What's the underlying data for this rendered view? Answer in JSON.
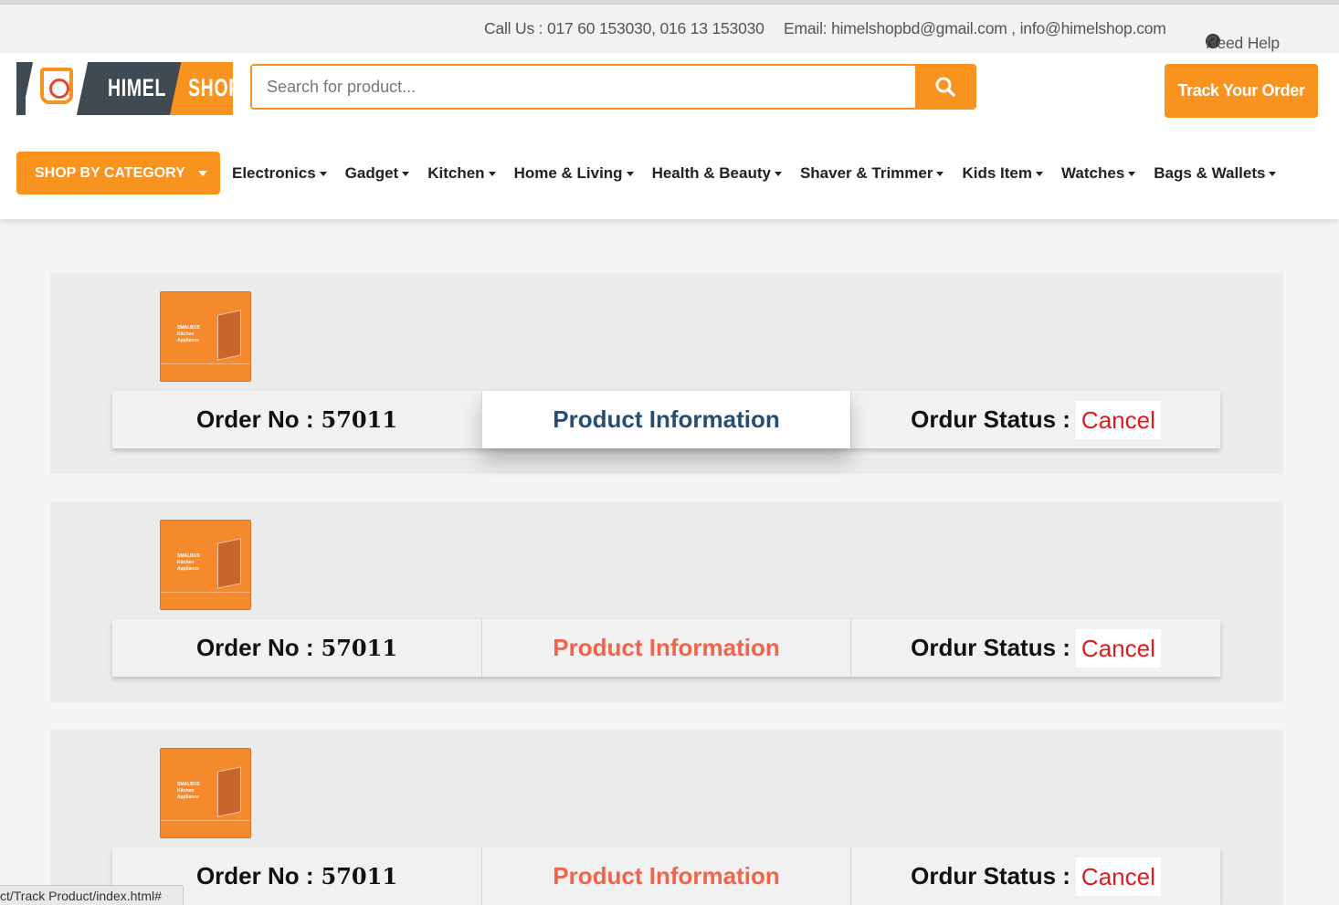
{
  "topbar": {
    "call": "Call Us : 017 60 153030, 016 13 153030",
    "email": "Email: himelshopbd@gmail.com , info@himelshop.com",
    "help": "Need Help"
  },
  "brand": {
    "logo_word1": "HIMEL",
    "logo_word2": "SHOP",
    "accent_color": "#f7931e"
  },
  "search": {
    "placeholder": "Search for product...",
    "value": ""
  },
  "track_button": "Track Your Order",
  "category_button": "SHOP BY CATEGORY",
  "nav": [
    "Electronics",
    "Gadget",
    "Kitchen",
    "Home & Living",
    "Health & Beauty",
    "Shaver & Trimmer",
    "Kids Item",
    "Watches",
    "Bags & Wallets"
  ],
  "orders": [
    {
      "order_label": "Order No :",
      "order_no": "57011",
      "product_label": "Product Information",
      "status_label": "Ordur Status :",
      "status": "Cancel",
      "thumb_text": "SMALBUS Kitchen Appliance"
    },
    {
      "order_label": "Order No :",
      "order_no": "57011",
      "product_label": "Product Information",
      "status_label": "Ordur Status :",
      "status": "Cancel",
      "thumb_text": "SMALBUS Kitchen Appliance"
    },
    {
      "order_label": "Order No :",
      "order_no": "57011",
      "product_label": "Product Information",
      "status_label": "Ordur Status :",
      "status": "Cancel",
      "thumb_text": "SMALBUS Kitchen Appliance"
    }
  ],
  "status_url": "ct/Track Product/index.html#"
}
